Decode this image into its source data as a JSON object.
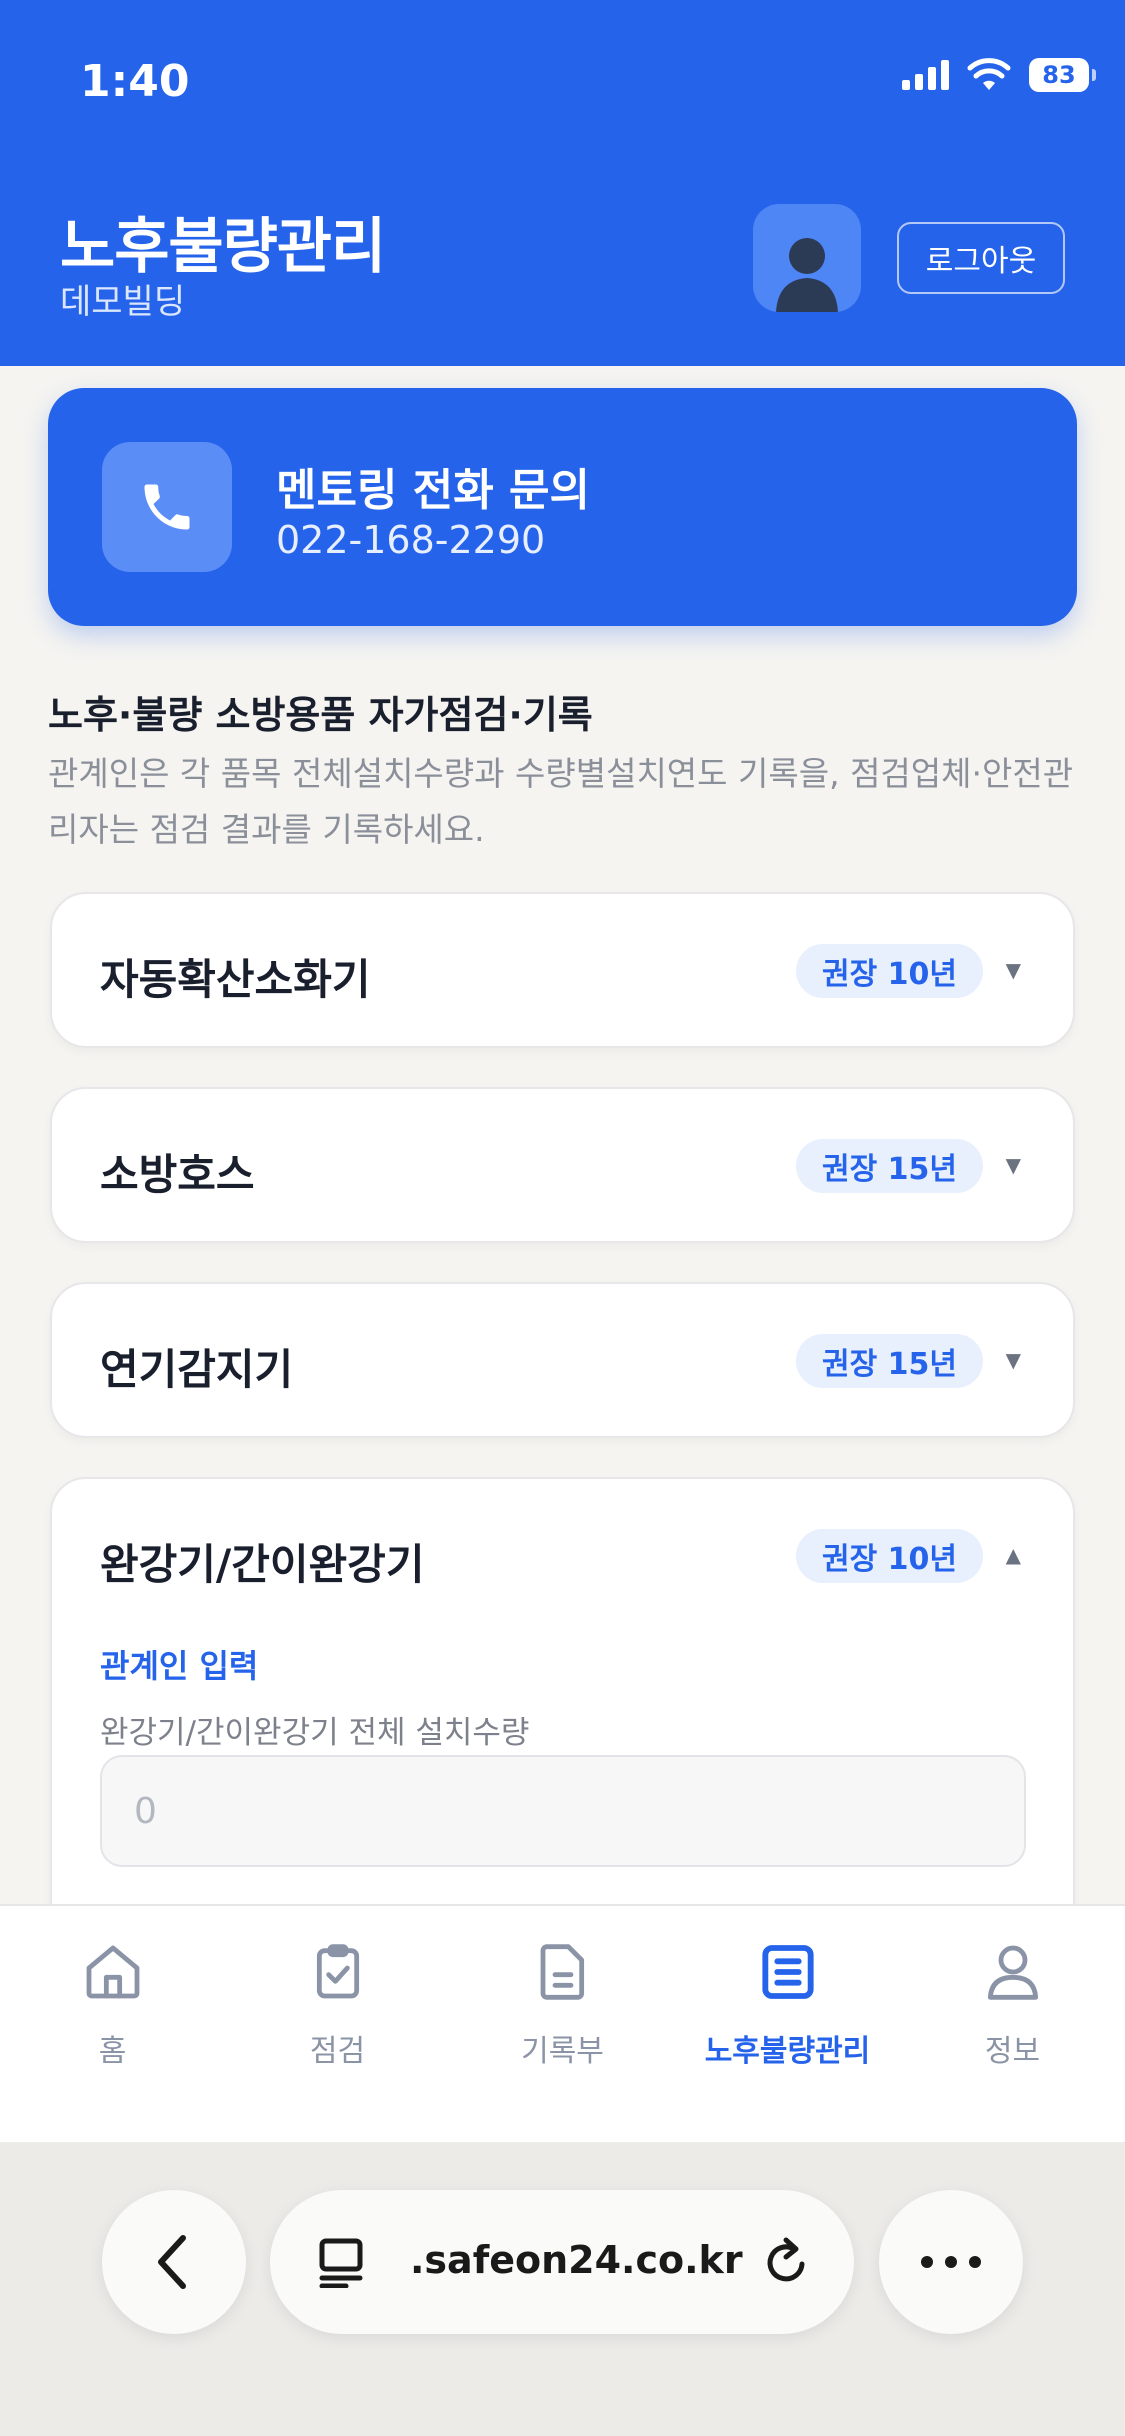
{
  "status_bar": {
    "time": "1:40",
    "battery": "83"
  },
  "header": {
    "title": "노후불량관리",
    "subtitle": "데모빌딩",
    "logout_label": "로그아웃"
  },
  "mentor": {
    "title": "멘토링 전화 문의",
    "phone": "022-168-2290"
  },
  "section": {
    "title": "노후·불량 소방용품 자가점검·기록",
    "description": "관계인은 각 품목 전체설치수량과 수량별설치연도 기록을, 점검업체·안전관리자는 점검 결과를 기록하세요."
  },
  "items": [
    {
      "name": "자동확산소화기",
      "badge": "권장 10년",
      "caret": "▼"
    },
    {
      "name": "소방호스",
      "badge": "권장 15년",
      "caret": "▼"
    },
    {
      "name": "연기감지기",
      "badge": "권장 15년",
      "caret": "▼"
    },
    {
      "name": "완강기/간이완강기",
      "badge": "권장 10년",
      "caret": "▲",
      "role_label": "관계인 입력",
      "field_label": "완강기/간이완강기 전체 설치수량",
      "field_placeholder": "0"
    }
  ],
  "nav": [
    {
      "label": "홈",
      "icon": "home-icon"
    },
    {
      "label": "점검",
      "icon": "clipboard-check-icon"
    },
    {
      "label": "기록부",
      "icon": "document-icon"
    },
    {
      "label": "노후불량관리",
      "icon": "list-document-icon",
      "active": true
    },
    {
      "label": "정보",
      "icon": "user-icon"
    }
  ],
  "browser": {
    "url": ".safeon24.co.kr"
  },
  "colors": {
    "primary": "#2563eb",
    "background": "#f5f4f1"
  }
}
